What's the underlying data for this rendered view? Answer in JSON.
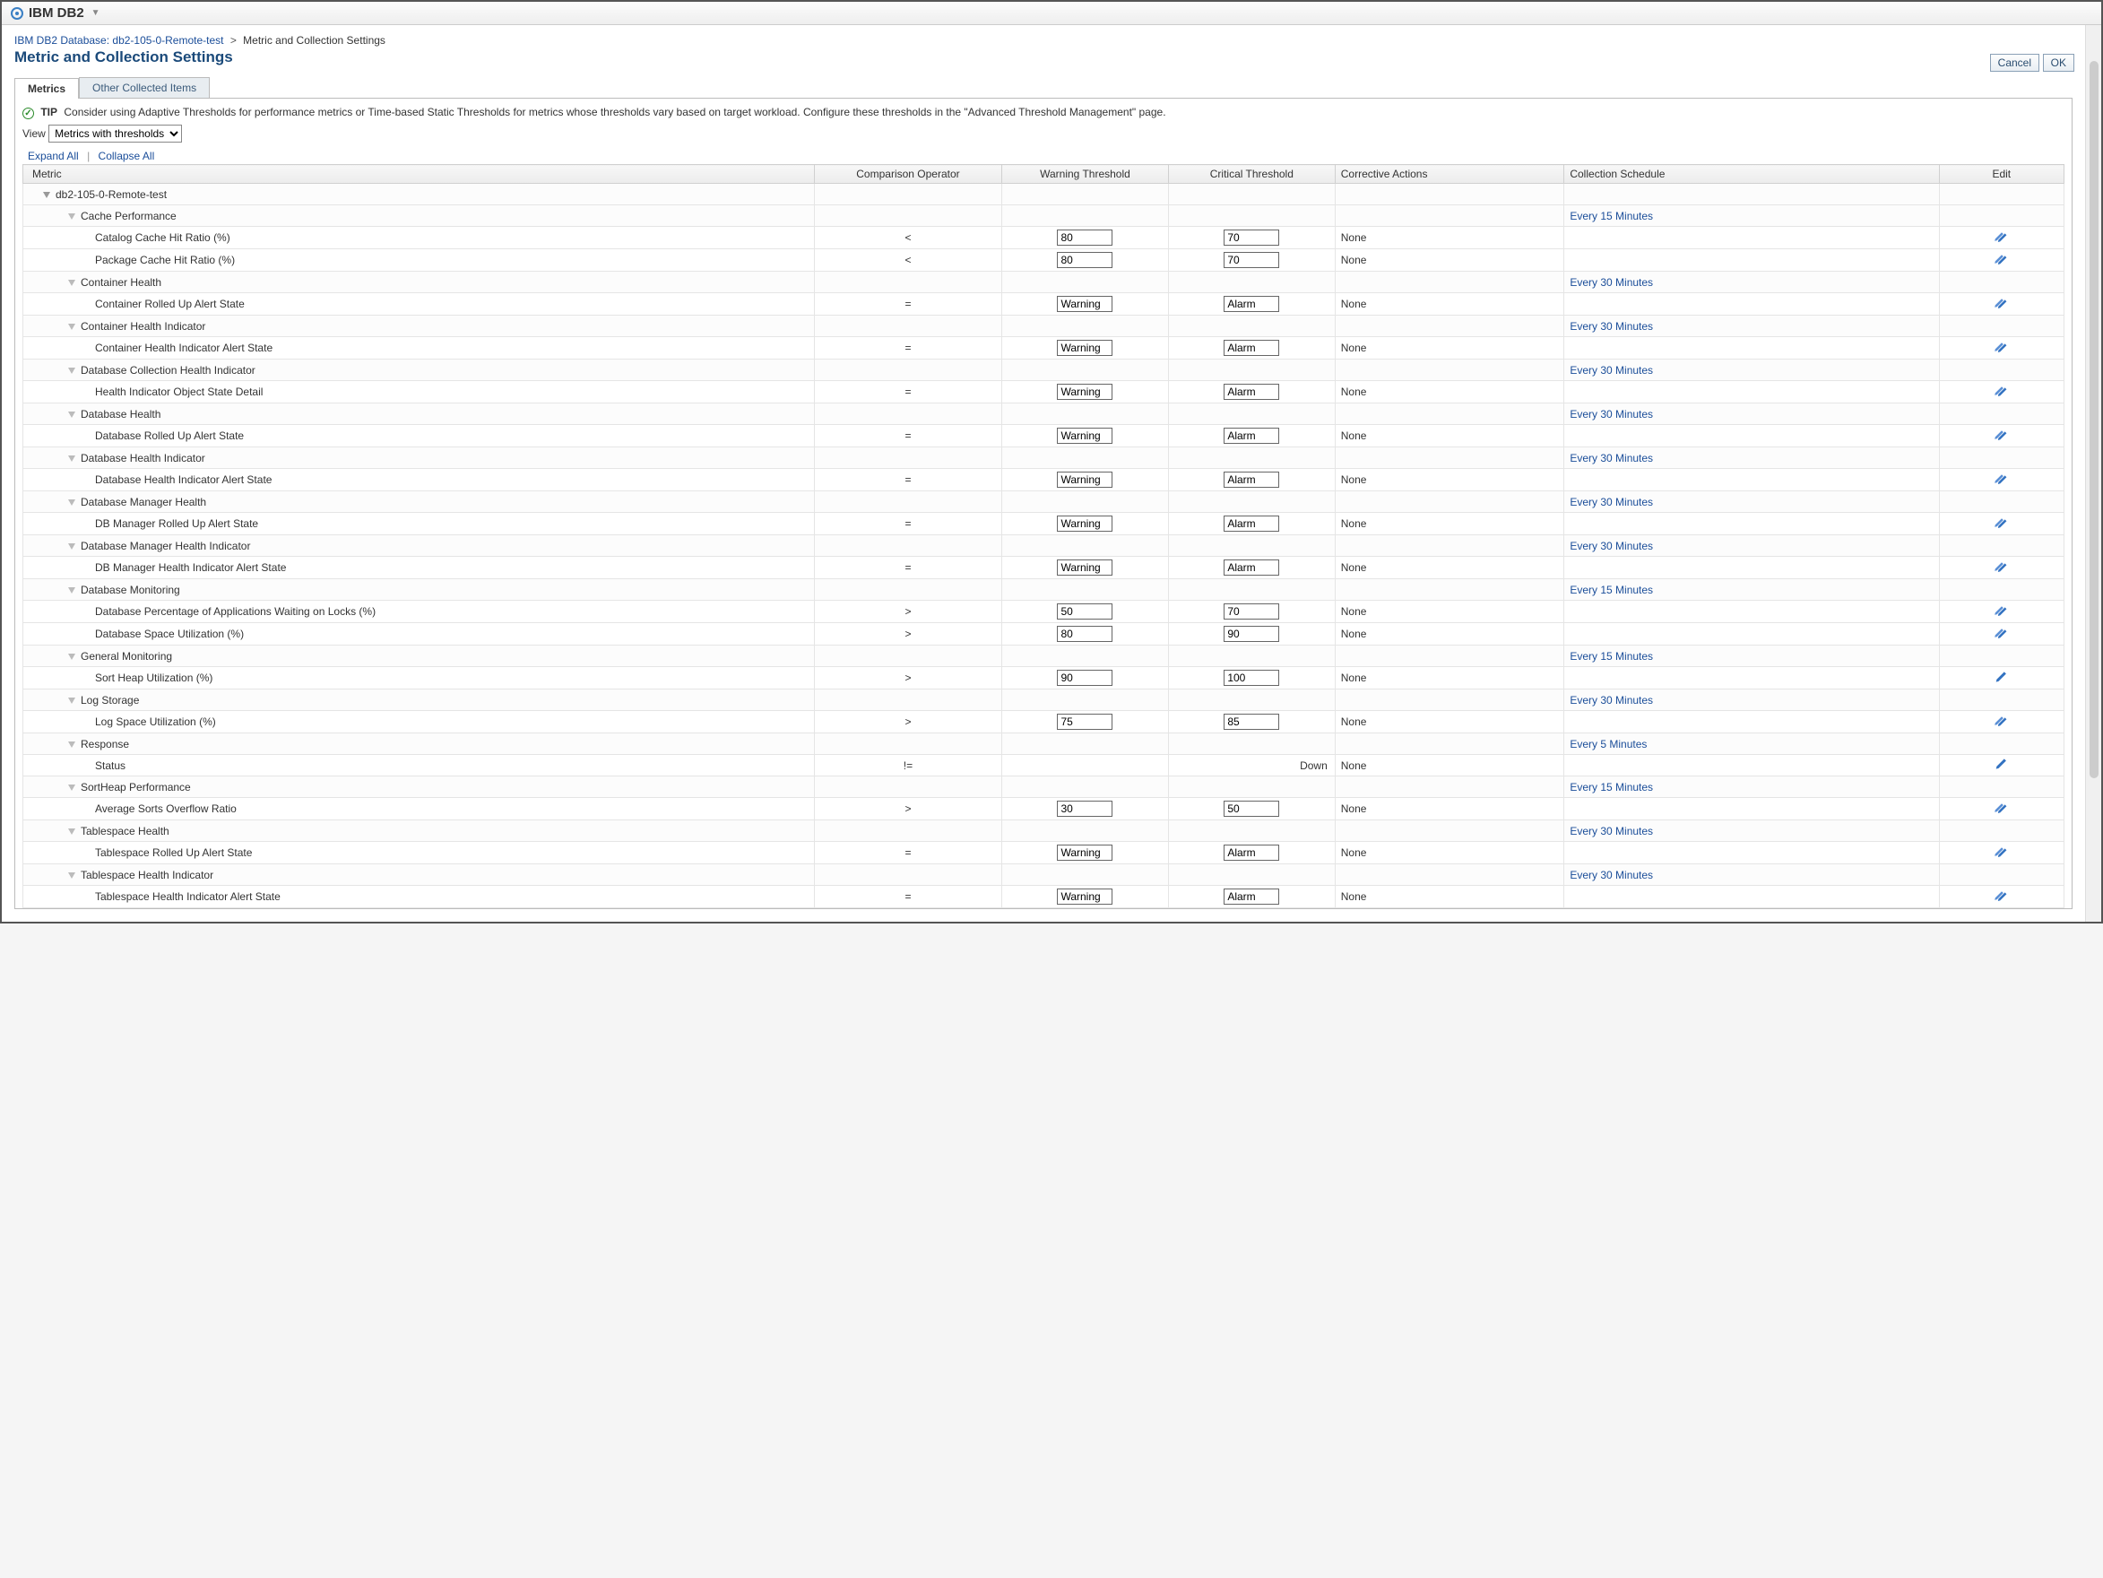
{
  "topbar": {
    "label": "IBM DB2"
  },
  "breadcrumb": {
    "parent_label": "IBM DB2 Database:",
    "parent_name": "db2-105-0-Remote-test",
    "sep": ">",
    "current": "Metric and Collection Settings"
  },
  "page_title": "Metric and Collection Settings",
  "buttons": {
    "cancel": "Cancel",
    "ok": "OK"
  },
  "tabs": {
    "metrics": "Metrics",
    "other": "Other Collected Items"
  },
  "tip": {
    "label": "TIP",
    "text": "Consider using Adaptive Thresholds for performance metrics or Time-based Static Thresholds for metrics whose thresholds vary based on target workload. Configure these thresholds in the \"Advanced Threshold Management\" page."
  },
  "view": {
    "label": "View",
    "selected": "Metrics with thresholds"
  },
  "expand": {
    "expand_all": "Expand All",
    "collapse_all": "Collapse All"
  },
  "columns": {
    "metric": "Metric",
    "comparison": "Comparison Operator",
    "warning": "Warning Threshold",
    "critical": "Critical Threshold",
    "corrective": "Corrective Actions",
    "schedule": "Collection Schedule",
    "edit": "Edit"
  },
  "root": {
    "name": "db2-105-0-Remote-test"
  },
  "groups": [
    {
      "name": "Cache Performance",
      "schedule": "Every 15 Minutes",
      "metrics": [
        {
          "name": "Catalog Cache Hit Ratio (%)",
          "op": "<",
          "warn": "80",
          "crit": "70",
          "corrective": "None",
          "edit": "multi"
        },
        {
          "name": "Package Cache Hit Ratio (%)",
          "op": "<",
          "warn": "80",
          "crit": "70",
          "corrective": "None",
          "edit": "multi"
        }
      ]
    },
    {
      "name": "Container Health",
      "schedule": "Every 30 Minutes",
      "metrics": [
        {
          "name": "Container Rolled Up Alert State",
          "op": "=",
          "warn": "Warning",
          "crit": "Alarm",
          "corrective": "None",
          "edit": "multi"
        }
      ]
    },
    {
      "name": "Container Health Indicator",
      "schedule": "Every 30 Minutes",
      "metrics": [
        {
          "name": "Container Health Indicator Alert State",
          "op": "=",
          "warn": "Warning",
          "crit": "Alarm",
          "corrective": "None",
          "edit": "multi"
        }
      ]
    },
    {
      "name": "Database Collection Health Indicator",
      "schedule": "Every 30 Minutes",
      "metrics": [
        {
          "name": "Health Indicator Object State Detail",
          "op": "=",
          "warn": "Warning",
          "crit": "Alarm",
          "corrective": "None",
          "edit": "multi"
        }
      ]
    },
    {
      "name": "Database Health",
      "schedule": "Every 30 Minutes",
      "metrics": [
        {
          "name": "Database Rolled Up Alert State",
          "op": "=",
          "warn": "Warning",
          "crit": "Alarm",
          "corrective": "None",
          "edit": "multi"
        }
      ]
    },
    {
      "name": "Database Health Indicator",
      "schedule": "Every 30 Minutes",
      "metrics": [
        {
          "name": "Database Health Indicator Alert State",
          "op": "=",
          "warn": "Warning",
          "crit": "Alarm",
          "corrective": "None",
          "edit": "multi"
        }
      ]
    },
    {
      "name": "Database Manager Health",
      "schedule": "Every 30 Minutes",
      "metrics": [
        {
          "name": "DB Manager Rolled Up Alert State",
          "op": "=",
          "warn": "Warning",
          "crit": "Alarm",
          "corrective": "None",
          "edit": "multi"
        }
      ]
    },
    {
      "name": "Database Manager Health Indicator",
      "schedule": "Every 30 Minutes",
      "metrics": [
        {
          "name": "DB Manager Health Indicator Alert State",
          "op": "=",
          "warn": "Warning",
          "crit": "Alarm",
          "corrective": "None",
          "edit": "multi"
        }
      ]
    },
    {
      "name": "Database Monitoring",
      "schedule": "Every 15 Minutes",
      "metrics": [
        {
          "name": "Database Percentage of Applications Waiting on Locks (%)",
          "op": ">",
          "warn": "50",
          "crit": "70",
          "corrective": "None",
          "edit": "multi"
        },
        {
          "name": "Database Space Utilization (%)",
          "op": ">",
          "warn": "80",
          "crit": "90",
          "corrective": "None",
          "edit": "multi"
        }
      ]
    },
    {
      "name": "General Monitoring",
      "schedule": "Every 15 Minutes",
      "metrics": [
        {
          "name": "Sort Heap Utilization (%)",
          "op": ">",
          "warn": "90",
          "crit": "100",
          "corrective": "None",
          "edit": "single"
        }
      ]
    },
    {
      "name": "Log Storage",
      "schedule": "Every 30 Minutes",
      "metrics": [
        {
          "name": "Log Space Utilization (%)",
          "op": ">",
          "warn": "75",
          "crit": "85",
          "corrective": "None",
          "edit": "multi"
        }
      ]
    },
    {
      "name": "Response",
      "schedule": "Every 5 Minutes",
      "metrics": [
        {
          "name": "Status",
          "op": "!=",
          "warn_text": "",
          "crit_text": "Down",
          "corrective": "None",
          "edit": "single"
        }
      ]
    },
    {
      "name": "SortHeap Performance",
      "schedule": "Every 15 Minutes",
      "metrics": [
        {
          "name": "Average Sorts Overflow Ratio",
          "op": ">",
          "warn": "30",
          "crit": "50",
          "corrective": "None",
          "edit": "multi"
        }
      ]
    },
    {
      "name": "Tablespace Health",
      "schedule": "Every 30 Minutes",
      "metrics": [
        {
          "name": "Tablespace Rolled Up Alert State",
          "op": "=",
          "warn": "Warning",
          "crit": "Alarm",
          "corrective": "None",
          "edit": "multi"
        }
      ]
    },
    {
      "name": "Tablespace Health Indicator",
      "schedule": "Every 30 Minutes",
      "metrics": [
        {
          "name": "Tablespace Health Indicator Alert State",
          "op": "=",
          "warn": "Warning",
          "crit": "Alarm",
          "corrective": "None",
          "edit": "multi"
        }
      ]
    }
  ]
}
